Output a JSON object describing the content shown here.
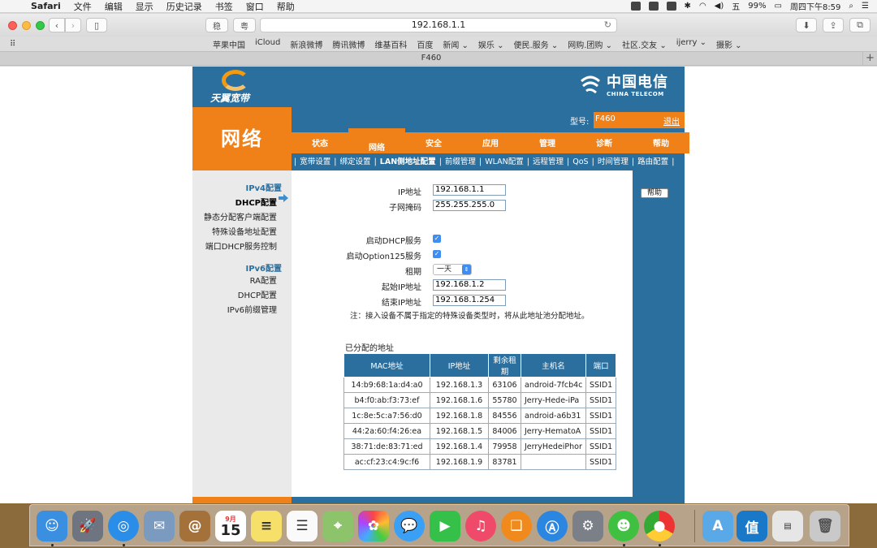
{
  "menubar": {
    "apple": "",
    "items": [
      "Safari",
      "文件",
      "编辑",
      "显示",
      "历史记录",
      "书签",
      "窗口",
      "帮助"
    ],
    "battery": "99%",
    "clock": "周四下午8:59"
  },
  "safari": {
    "url": "192.168.1.1",
    "ext1": "稳",
    "ext2": "粤",
    "bookmarks": [
      "苹果中国",
      "iCloud",
      "新浪微博",
      "腾讯微博",
      "维基百科",
      "百度",
      "新闻 ⌄",
      "娱乐 ⌄",
      "便民.服务 ⌄",
      "网购.团购 ⌄",
      "社区.交友 ⌄",
      "ijerry ⌄",
      "摄影 ⌄"
    ],
    "tab_title": "F460"
  },
  "router": {
    "brand_left": "天翼宽带",
    "brand_right_cn": "中国电信",
    "brand_right_en": "CHINA TELECOM",
    "section_title": "网络",
    "model_label": "型号:",
    "model_value": "F460",
    "logout": "退出",
    "tabs": [
      "状态",
      "网络",
      "安全",
      "应用",
      "管理",
      "诊断",
      "帮助"
    ],
    "active_tab": "网络",
    "subnav": [
      "宽带设置",
      "绑定设置",
      "LAN侧地址配置",
      "前缀管理",
      "WLAN配置",
      "远程管理",
      "QoS",
      "时间管理",
      "路由配置"
    ],
    "active_subnav": "LAN侧地址配置",
    "left_nav": {
      "ipv4_group": "IPv4配置",
      "ipv4_items": [
        "DHCP配置",
        "静态分配客户端配置",
        "特殊设备地址配置",
        "端口DHCP服务控制"
      ],
      "ipv6_group": "IPv6配置",
      "ipv6_items": [
        "RA配置",
        "DHCP配置",
        "IPv6前缀管理"
      ]
    },
    "help_button": "帮助",
    "form": {
      "ip_label": "IP地址",
      "ip_value": "192.168.1.1",
      "mask_label": "子网掩码",
      "mask_value": "255.255.255.0",
      "dhcp_label": "启动DHCP服务",
      "dhcp_checked": true,
      "opt125_label": "启动Option125服务",
      "opt125_checked": true,
      "lease_label": "租期",
      "lease_value": "一天",
      "start_label": "起始IP地址",
      "start_value": "192.168.1.2",
      "end_label": "结束IP地址",
      "end_value": "192.168.1.254",
      "note": "注：接入设备不属于指定的特殊设备类型时，将从此地址池分配地址。"
    },
    "assigned_title": "已分配的地址",
    "table": {
      "headers": [
        "MAC地址",
        "IP地址",
        "剩余租期",
        "主机名",
        "端口"
      ],
      "rows": [
        [
          "14:b9:68:1a:d4:a0",
          "192.168.1.3",
          "63106",
          "android-7fcb4c",
          "SSID1"
        ],
        [
          "b4:f0:ab:f3:73:ef",
          "192.168.1.6",
          "55780",
          "Jerry-Hede-iPa",
          "SSID1"
        ],
        [
          "1c:8e:5c:a7:56:d0",
          "192.168.1.8",
          "84556",
          "android-a6b31",
          "SSID1"
        ],
        [
          "44:2a:60:f4:26:ea",
          "192.168.1.5",
          "84006",
          "Jerry-HematoA",
          "SSID1"
        ],
        [
          "38:71:de:83:71:ed",
          "192.168.1.4",
          "79958",
          "JerryHedeiPhor",
          "SSID1"
        ],
        [
          "ac:cf:23:c4:9c:f6",
          "192.168.1.9",
          "83781",
          "",
          "SSID1"
        ]
      ]
    }
  },
  "colors": {
    "router_blue": "#2b6f9e",
    "router_orange": "#f08119"
  },
  "dock": {
    "calendar_month": "9月",
    "calendar_day": "15"
  }
}
